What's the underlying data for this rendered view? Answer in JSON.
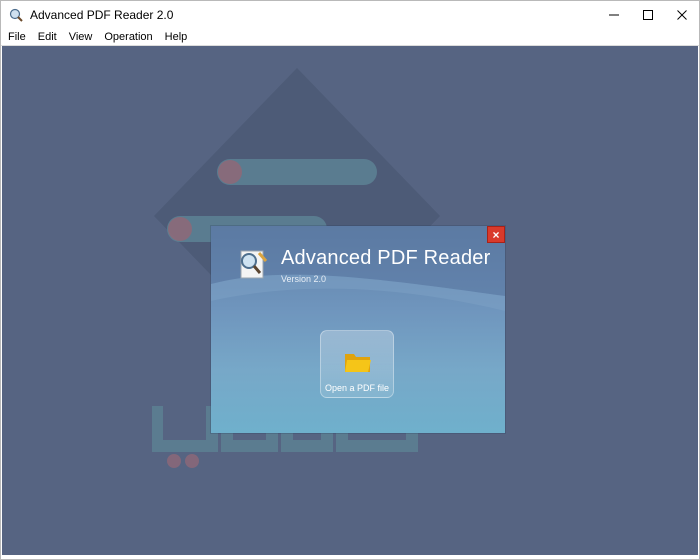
{
  "window": {
    "title": "Advanced PDF Reader 2.0",
    "icon": "app-icon"
  },
  "menu": {
    "items": [
      "File",
      "Edit",
      "View",
      "Operation",
      "Help"
    ]
  },
  "dialog": {
    "title": "Advanced PDF Reader",
    "version": "Version 2.0",
    "close_label": "×",
    "open_button_label": "Open a PDF file"
  },
  "colors": {
    "workspace": "#566482",
    "close_button": "#d93a2b",
    "folder": "#f5c518"
  }
}
